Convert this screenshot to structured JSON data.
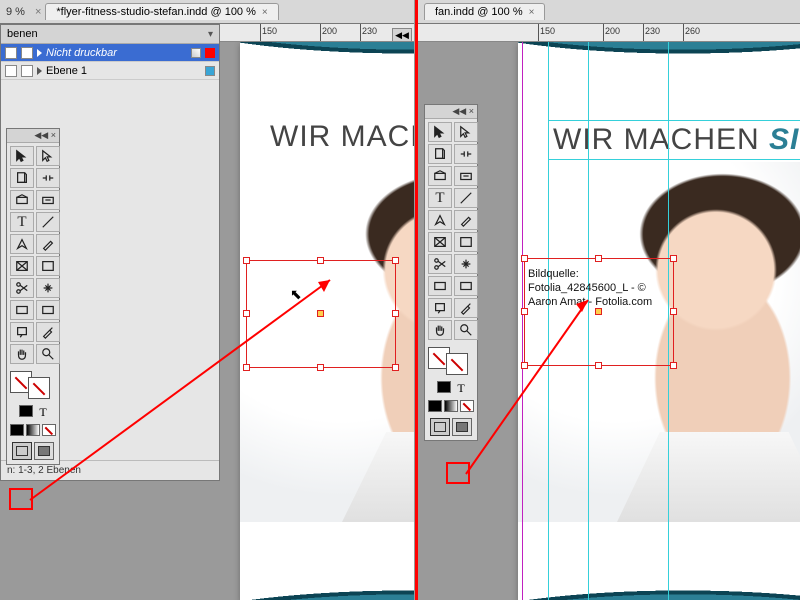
{
  "tab": {
    "title_left": "*flyer-fitness-studio-stefan.indd @ 100 %",
    "title_right": "fan.indd @ 100 %"
  },
  "ruler": {
    "left_ticks": [
      150,
      200,
      230
    ],
    "right_ticks": [
      150,
      200,
      230,
      260
    ]
  },
  "layers": {
    "panel_title": "benen",
    "items": [
      {
        "name": "Nicht druckbar",
        "selected": true,
        "color": "#ff0000"
      },
      {
        "name": "Ebene 1",
        "selected": false,
        "color": "#39a5d6"
      }
    ],
    "footer": "n: 1-3, 2 Ebenen"
  },
  "tool_names": [
    "selection",
    "direct-selection",
    "page",
    "gap",
    "content-collector",
    "content-placer",
    "type",
    "line",
    "pen",
    "pencil",
    "rectangle-frame",
    "rectangle",
    "scissors",
    "free-transform",
    "gradient-swatch",
    "gradient-feather",
    "note",
    "eyedropper",
    "hand",
    "zoom"
  ],
  "headline": {
    "left": "WIR MACHE",
    "right_plain": "WIR MACHEN ",
    "right_accent": "SIE FIT!"
  },
  "credit": {
    "line1": "Bildquelle:",
    "line2": "Fotolia_42845600_L - ©",
    "line3": "Aaron Amat - Fotolia.com"
  },
  "mode_icons": {
    "normal": "normal-view",
    "preview": "preview-view"
  }
}
